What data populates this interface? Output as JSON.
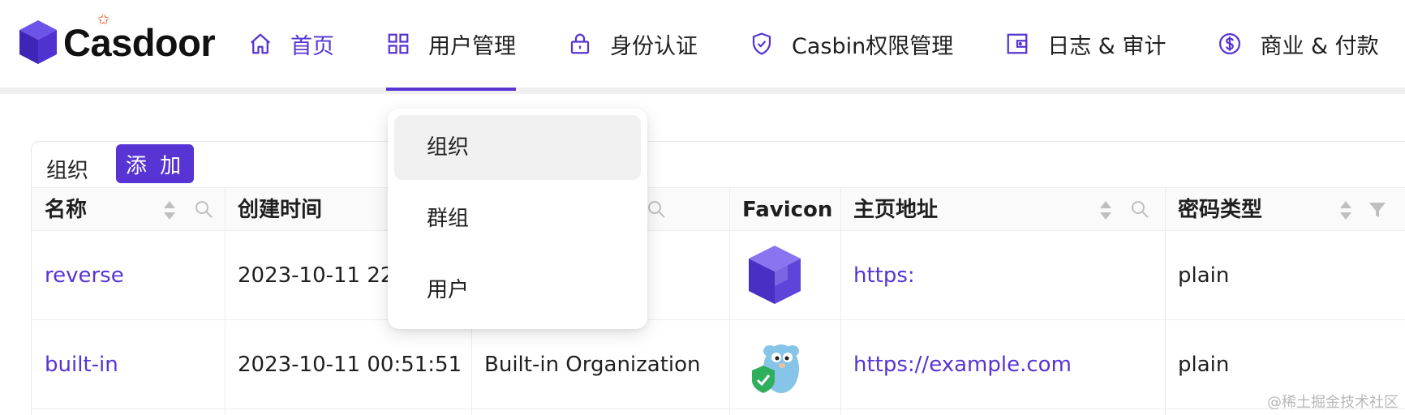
{
  "app": {
    "name": "Casdoor"
  },
  "nav": {
    "items": [
      {
        "label": "首页",
        "icon": "home-icon"
      },
      {
        "label": "用户管理",
        "icon": "grid-icon"
      },
      {
        "label": "身份认证",
        "icon": "lock-icon"
      },
      {
        "label": "Casbin权限管理",
        "icon": "shield-check-icon"
      },
      {
        "label": "日志 & 审计",
        "icon": "wallet-icon"
      },
      {
        "label": "商业 & 付款",
        "icon": "dollar-icon"
      }
    ],
    "active_color": "#5734d3"
  },
  "dropdown": {
    "items": [
      "组织",
      "群组",
      "用户"
    ]
  },
  "table": {
    "title": "组织",
    "add_label": "添 加",
    "columns": [
      "名称",
      "创建时间",
      "Favicon",
      "主页地址",
      "密码类型"
    ],
    "rows": [
      {
        "name": "reverse",
        "created": "2023-10-11 22",
        "display_name": "",
        "favicon": "casdoor-cube-icon",
        "homepage": "https:",
        "password_type": "plain"
      },
      {
        "name": "built-in",
        "created": "2023-10-11 00:51:51",
        "display_name": "Built-in Organization",
        "favicon": "gopher-shield-icon",
        "homepage": "https://example.com",
        "password_type": "plain"
      }
    ]
  },
  "watermark": "@稀土掘金技术社区"
}
